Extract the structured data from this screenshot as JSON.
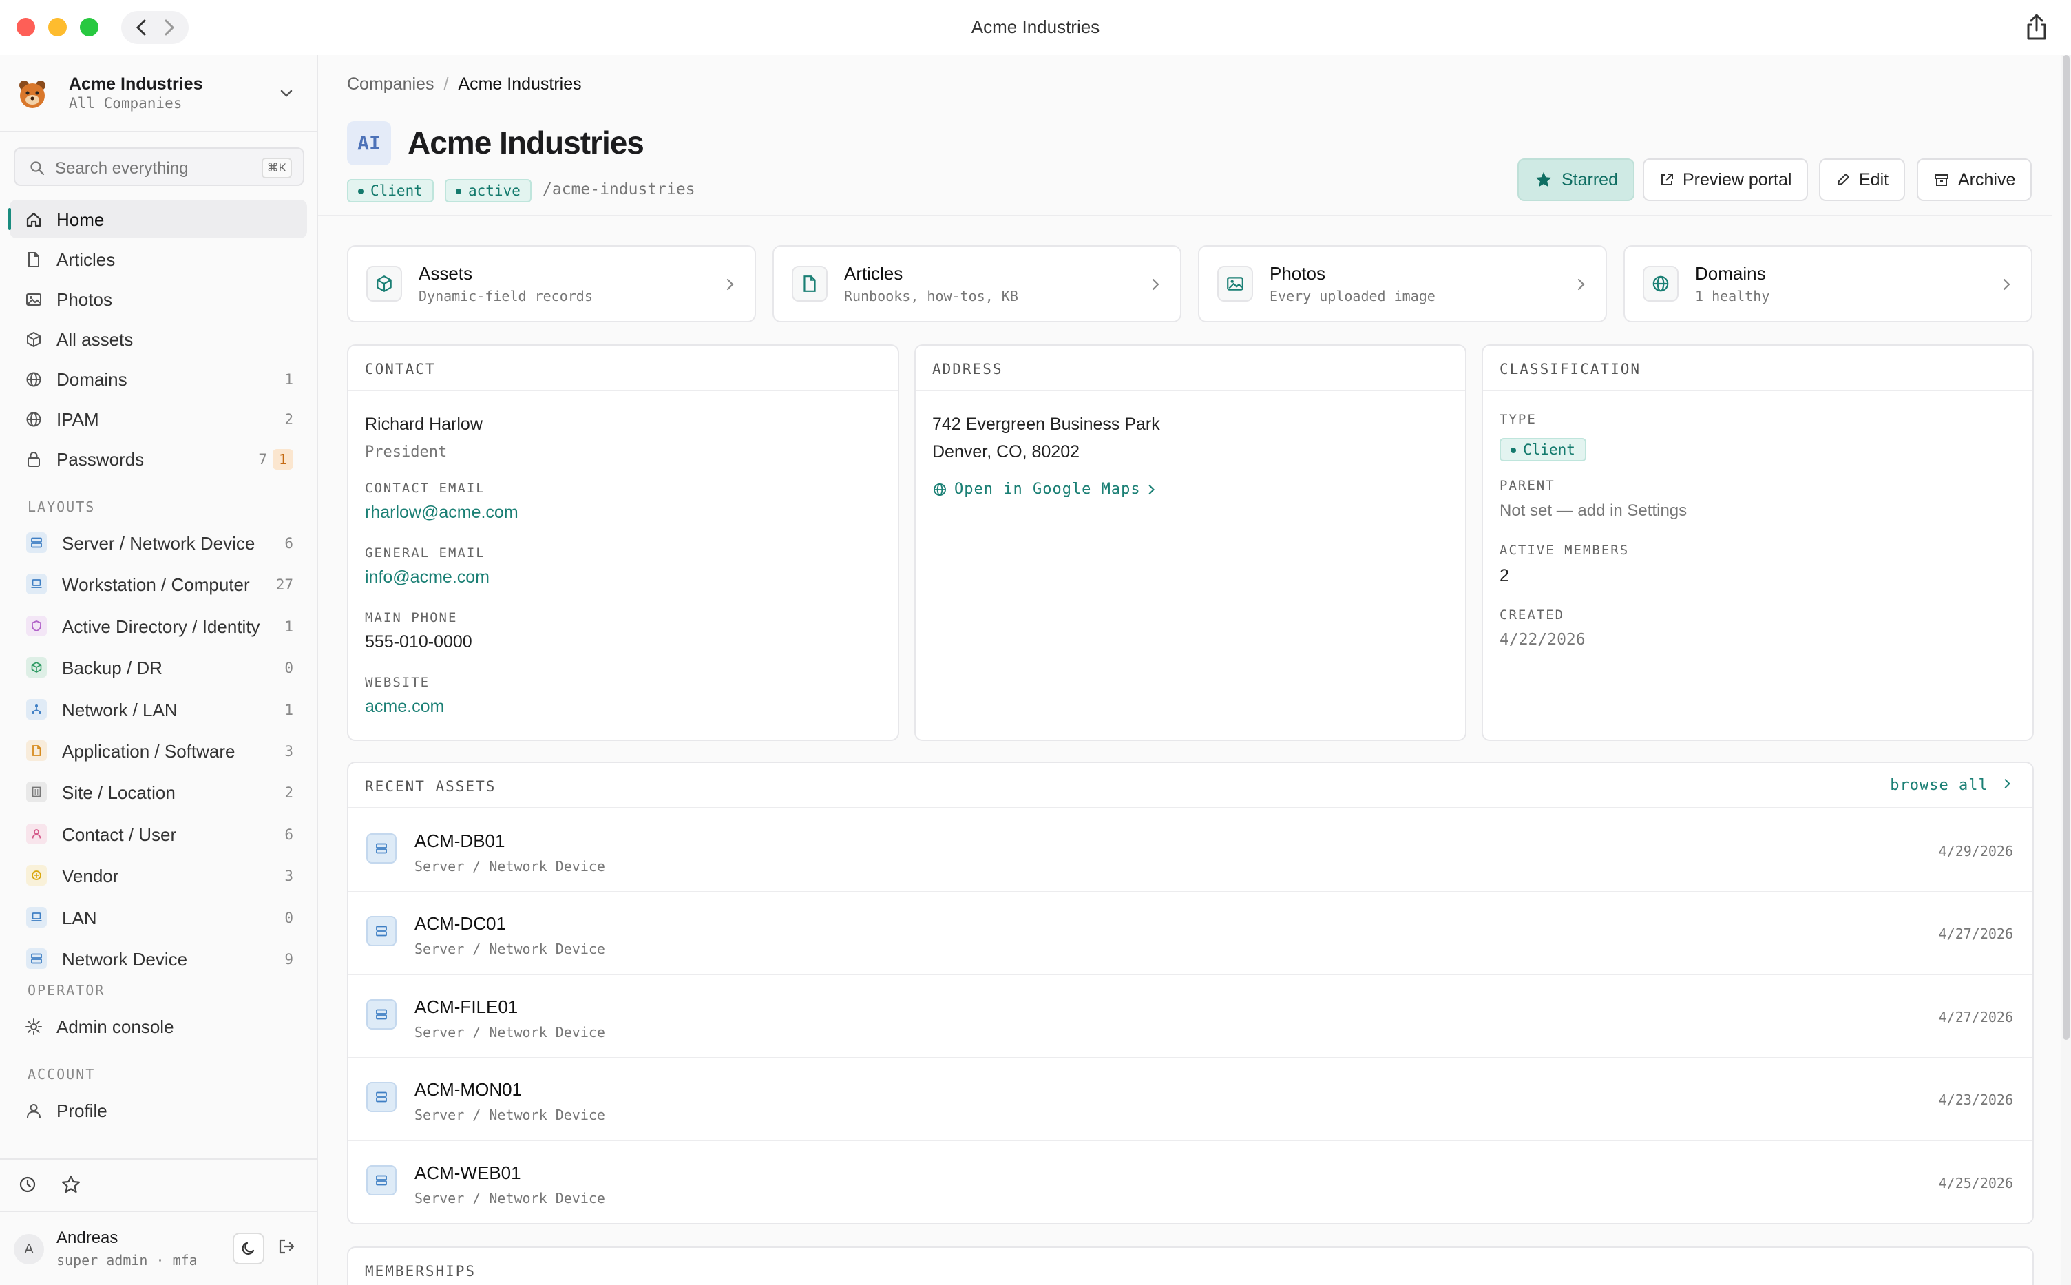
{
  "window": {
    "title": "Acme Industries"
  },
  "sidebar": {
    "company": {
      "name": "Acme Industries",
      "sub": "All Companies"
    },
    "search": {
      "placeholder": "Search everything",
      "shortcut": "⌘K"
    },
    "nav": [
      {
        "label": "Home",
        "count": "",
        "icon": "home-icon"
      },
      {
        "label": "Articles",
        "count": "",
        "icon": "document-icon"
      },
      {
        "label": "Photos",
        "count": "",
        "icon": "image-icon"
      },
      {
        "label": "All assets",
        "count": "",
        "icon": "box-icon"
      },
      {
        "label": "Domains",
        "count": "1",
        "icon": "globe-icon"
      },
      {
        "label": "IPAM",
        "count": "2",
        "icon": "globe-icon"
      },
      {
        "label": "Passwords",
        "count": "7",
        "badge": "1",
        "icon": "lock-icon"
      }
    ],
    "layouts_label": "LAYOUTS",
    "layouts": [
      {
        "label": "Server / Network Device",
        "count": "6",
        "icon": "server-icon",
        "color": "#3f7fc4"
      },
      {
        "label": "Workstation / Computer",
        "count": "27",
        "icon": "laptop-icon",
        "color": "#3f7fc4"
      },
      {
        "label": "Active Directory / Identity",
        "count": "1",
        "icon": "shield-icon",
        "color": "#b163c9"
      },
      {
        "label": "Backup / DR",
        "count": "0",
        "icon": "box-icon",
        "color": "#2f9a63"
      },
      {
        "label": "Network / LAN",
        "count": "1",
        "icon": "network-icon",
        "color": "#3f7fc4"
      },
      {
        "label": "Application / Software",
        "count": "3",
        "icon": "document-icon",
        "color": "#d68a1d"
      },
      {
        "label": "Site / Location",
        "count": "2",
        "icon": "building-icon",
        "color": "#777777"
      },
      {
        "label": "Contact / User",
        "count": "6",
        "icon": "person-icon",
        "color": "#d45a8a"
      },
      {
        "label": "Vendor",
        "count": "3",
        "icon": "vendor-icon",
        "color": "#d9a70f"
      },
      {
        "label": "LAN",
        "count": "0",
        "icon": "laptop-icon",
        "color": "#3f7fc4"
      },
      {
        "label": "Network Device",
        "count": "9",
        "icon": "server-icon",
        "color": "#3f7fc4"
      }
    ],
    "operator_label": "OPERATOR",
    "admin_console": "Admin console",
    "account_label": "ACCOUNT",
    "profile": "Profile",
    "user": {
      "initial": "A",
      "name": "Andreas",
      "role": "super admin · mfa"
    }
  },
  "main": {
    "breadcrumb": {
      "parent": "Companies",
      "sep": "/",
      "current": "Acme Industries"
    },
    "badge": "AI",
    "title": "Acme Industries",
    "tags": {
      "type": "Client",
      "status": "active"
    },
    "slug": "/acme-industries",
    "actions": {
      "starred": "Starred",
      "preview": "Preview portal",
      "edit": "Edit",
      "archive": "Archive"
    },
    "quick": [
      {
        "title": "Assets",
        "sub": "Dynamic-field records"
      },
      {
        "title": "Articles",
        "sub": "Runbooks, how-tos, KB"
      },
      {
        "title": "Photos",
        "sub": "Every uploaded image"
      },
      {
        "title": "Domains",
        "sub": "1 healthy"
      }
    ],
    "contact": {
      "header": "CONTACT",
      "name": "Richard Harlow",
      "role": "President",
      "contact_email_label": "CONTACT EMAIL",
      "contact_email": "rharlow@acme.com",
      "general_email_label": "GENERAL EMAIL",
      "general_email": "info@acme.com",
      "phone_label": "MAIN PHONE",
      "phone": "555-010-0000",
      "website_label": "WEBSITE",
      "website": "acme.com"
    },
    "address": {
      "header": "ADDRESS",
      "line1": "742 Evergreen Business Park",
      "line2": "Denver, CO, 80202",
      "maps_link": "Open in Google Maps"
    },
    "classification": {
      "header": "CLASSIFICATION",
      "type_label": "TYPE",
      "type": "Client",
      "parent_label": "PARENT",
      "parent": "Not set — add in Settings",
      "members_label": "ACTIVE MEMBERS",
      "members": "2",
      "created_label": "CREATED",
      "created": "4/22/2026"
    },
    "recent_assets": {
      "header": "RECENT ASSETS",
      "browse_all": "browse all",
      "rows": [
        {
          "name": "ACM-DB01",
          "type": "Server / Network Device",
          "date": "4/29/2026"
        },
        {
          "name": "ACM-DC01",
          "type": "Server / Network Device",
          "date": "4/27/2026"
        },
        {
          "name": "ACM-FILE01",
          "type": "Server / Network Device",
          "date": "4/27/2026"
        },
        {
          "name": "ACM-MON01",
          "type": "Server / Network Device",
          "date": "4/23/2026"
        },
        {
          "name": "ACM-WEB01",
          "type": "Server / Network Device",
          "date": "4/25/2026"
        }
      ]
    },
    "memberships": {
      "header": "MEMBERSHIPS"
    }
  },
  "colors": {
    "accent": "#1a8c7f",
    "starred_bg": "#cfeae4"
  }
}
